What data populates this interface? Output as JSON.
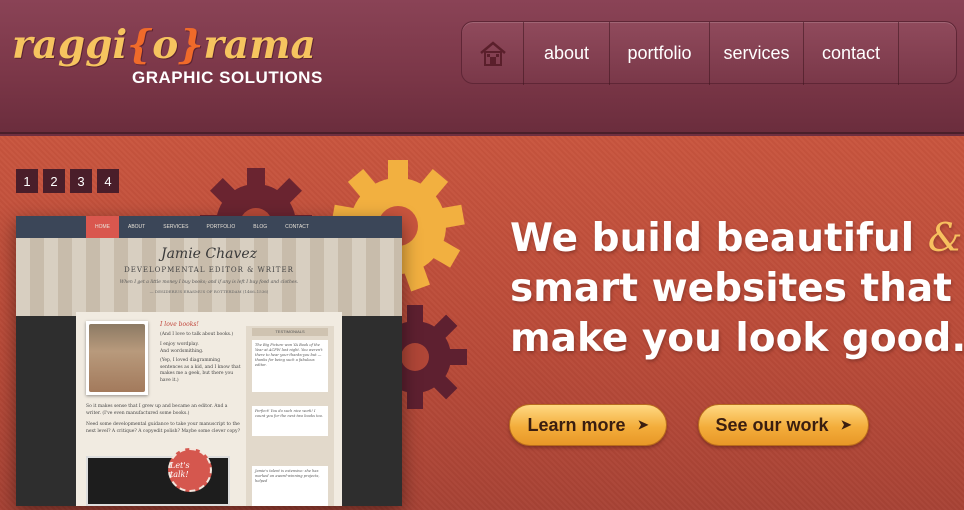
{
  "header": {
    "logo": {
      "part1": "raggi",
      "bracket_open": "{",
      "part2": "o",
      "bracket_close": "}",
      "part3": "rama",
      "tagline": "GRAPHIC SOLUTIONS"
    },
    "nav": [
      {
        "label": "about"
      },
      {
        "label": "portfolio"
      },
      {
        "label": "services"
      },
      {
        "label": "contact"
      }
    ]
  },
  "hero": {
    "pager": [
      "1",
      "2",
      "3",
      "4"
    ],
    "headline": {
      "line1": "We build beautiful",
      "amp": "&",
      "line2": "smart websites that",
      "line3": "make you look good."
    },
    "buttons": {
      "learn_more": "Learn more",
      "see_work": "See our work",
      "arrow": "➤"
    }
  },
  "slide": {
    "nav": [
      "HOME",
      "ABOUT",
      "SERVICES",
      "PORTFOLIO",
      "BLOG",
      "CONTACT"
    ],
    "name": "Jamie Chavez",
    "subtitle": "DEVELOPMENTAL EDITOR & WRITER",
    "quote": "When I get a little money I buy books; and if any is left I buy food and clothes.",
    "cite": "— DESIDERIUS ERASMUS OF ROTTERDAM (1466–1536)",
    "love_heading": "I love books!",
    "intro": [
      "(And I love to talk about books.)",
      "I enjoy wordplay.",
      "And wordsmithing.",
      "(Yep, I loved diagramming sentences as a kid, and I know that makes me a geek, but there you have it.)"
    ],
    "para1": "So it makes sense that I grew up and became an editor. And a writer. (I've even manufactured some books.)",
    "para2": "Need some developmental guidance to take your manuscript to the next level? A critique? A copyedit polish? Maybe some clever copy?",
    "sidebar_title": "TESTIMONIALS",
    "testimonials": [
      "The Big Picture won YA Book of the Year at ACFW last night. You weren't there to hear your thanks-you but — thanks for being such a fabulous editor.",
      "Perfect! You do such nice work! I count you for the next two books too.",
      "Jamie's talent is extensive: she has worked on award-winning projects, helped"
    ],
    "talk": "Let's talk!"
  },
  "colors": {
    "header_bg": "#7a3647",
    "hero_bg": "#b84a38",
    "logo_gold": "#f6c45f",
    "logo_bracket": "#f06a2a",
    "button": "#f3ad3b",
    "gear_gold": "#f2b040",
    "gear_dark": "#6a2430"
  }
}
